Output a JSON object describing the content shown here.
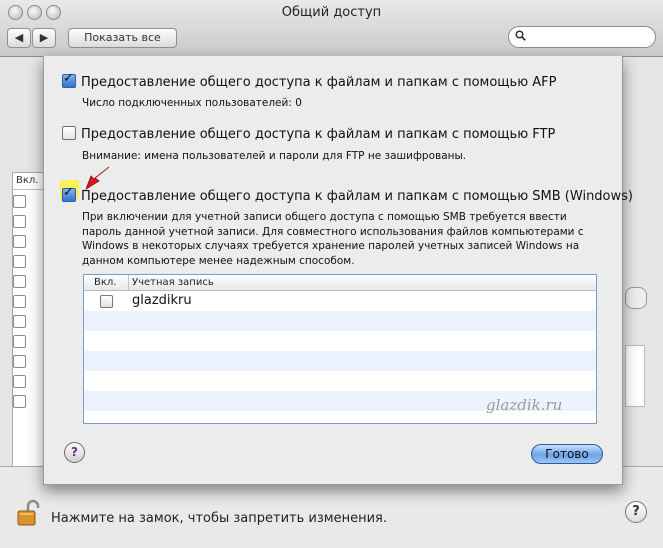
{
  "window": {
    "title": "Общий доступ",
    "show_all": "Показать все",
    "search_placeholder": ""
  },
  "background": {
    "services_header": "Вкл."
  },
  "sheet": {
    "afp": {
      "label": "Предоставление общего доступа к файлам и папкам с помощью AFP",
      "checked": true,
      "sub": "Число подключенных пользователей: 0"
    },
    "ftp": {
      "label": "Предоставление общего доступа к файлам и папкам с помощью FTP",
      "checked": false,
      "sub": "Внимание: имена пользователей и пароли для FTP не зашифрованы."
    },
    "smb": {
      "label": "Предоставление общего доступа к файлам и папкам с помощью SMB (Windows)",
      "checked": true,
      "description": "При включении для учетной записи общего доступа с помощью SMB требуется ввести пароль данной учетной записи. Для совместного использования файлов компьютерами с Windows в некоторых случаях требуется хранение паролей учетных записей Windows на данном компьютере менее надежным способом."
    },
    "table": {
      "col_enabled": "Вкл.",
      "col_account": "Учетная запись",
      "rows": [
        {
          "account": "glazdikru",
          "enabled": false
        }
      ]
    },
    "watermark": "glazdik.ru",
    "help": "?",
    "done": "Готово"
  },
  "bottom": {
    "lock_text": "Нажмите на замок, чтобы запретить изменения.",
    "help": "?"
  },
  "colors": {
    "highlight": "#f7f15a",
    "arrow": "#e0141a",
    "default_button": "#6aa4ea"
  },
  "icons": {
    "lock": "lock-open-icon",
    "search": "search-icon",
    "arrow": "red-arrow-icon"
  }
}
